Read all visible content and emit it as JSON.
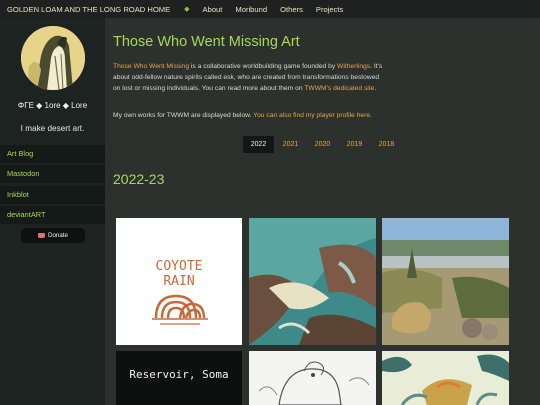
{
  "header": {
    "site_title": "GOLDEN LOAM AND THE LONG ROAD HOME",
    "separator": "◆",
    "nav": [
      "About",
      "Moribund",
      "Others",
      "Projects"
    ]
  },
  "sidebar": {
    "tagline": "ΦΓΕ ◆ 1ore ◆ Lore",
    "blurb": "I make desert art.",
    "links": [
      "Art Blog",
      "Mastodon",
      "Inkblot",
      "deviantART"
    ],
    "donate_label": "Donate"
  },
  "main": {
    "title": "Those Who Went Missing Art",
    "intro": {
      "link_game": "Those Who Went Missing",
      "t1": " is a collaborative worldbuilding game founded by ",
      "link_founder": "Witherlings",
      "t2": ". It's about odd-fellow nature spirits called esk, who are created from transformations bestowed on lost or missing individuals. You can read more about them on ",
      "link_site": "TWWM's dedicated site",
      "t3": "."
    },
    "intro2": {
      "t1": "My own works for TWWM are displayed below. ",
      "link_profile": "You can also find my player profile here."
    },
    "years": [
      "2022",
      "2021",
      "2020",
      "2019",
      "2018"
    ],
    "active_year": "2022",
    "section_heading": "2022-23",
    "gallery": [
      {
        "caption_line1": "COYOTE",
        "caption_line2": "RAIN"
      },
      {
        "caption": ""
      },
      {
        "caption": ""
      },
      {
        "caption": "Reservoir, Soma"
      },
      {
        "caption": ""
      },
      {
        "caption": ""
      }
    ]
  },
  "colors": {
    "accent_green": "#a7d957",
    "accent_orange": "#e8a347",
    "background": "#2d312e",
    "sidebar": "#1d2321"
  }
}
